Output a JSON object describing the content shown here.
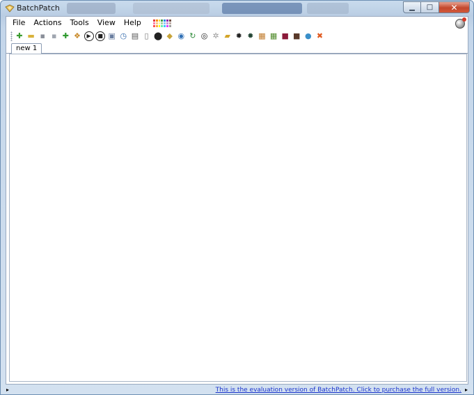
{
  "window": {
    "title": "BatchPatch",
    "controls": {
      "minimize": "▁",
      "maximize": "□",
      "close": "✕"
    }
  },
  "menu": {
    "items": [
      "File",
      "Actions",
      "Tools",
      "View",
      "Help"
    ],
    "palette": [
      "#e53935",
      "#fb8c00",
      "#fdd835",
      "#43a047",
      "#1e88e5",
      "#8e24aa",
      "#6d4c41",
      "#ff80ab",
      "#ffcc80",
      "#fff59d",
      "#a5d6a7",
      "#90caf9",
      "#ce93d8",
      "#bcaaa4",
      "#ff5252",
      "#ffab40",
      "#ffff00",
      "#69f0ae",
      "#40c4ff",
      "#e040fb",
      "#9e9e9e"
    ]
  },
  "toolbar": {
    "icons": [
      {
        "name": "new-icon",
        "glyph": "✚",
        "color": "#3b9b2f",
        "shape": "plain"
      },
      {
        "name": "open-icon",
        "glyph": "▬",
        "color": "#d9b23b",
        "shape": "plain"
      },
      {
        "name": "save-icon",
        "glyph": "▪",
        "color": "#8a8f99",
        "shape": "plain"
      },
      {
        "name": "save-as-icon",
        "glyph": "▪",
        "color": "#a0a6b0",
        "shape": "plain"
      },
      {
        "name": "add-hosts-icon",
        "glyph": "✚",
        "color": "#2f9a2f",
        "shape": "plain"
      },
      {
        "name": "group-icon",
        "glyph": "❖",
        "color": "#c98a2a",
        "shape": "plain"
      },
      {
        "name": "play-icon",
        "glyph": "▶",
        "color": "#222222",
        "shape": "circle"
      },
      {
        "name": "stop-icon",
        "glyph": "■",
        "color": "#222222",
        "shape": "circle"
      },
      {
        "name": "copy-icon",
        "glyph": "▣",
        "color": "#6b7fa0",
        "shape": "plain"
      },
      {
        "name": "clock-icon",
        "glyph": "◷",
        "color": "#3a6fb0",
        "shape": "plain"
      },
      {
        "name": "monitor-icon",
        "glyph": "▤",
        "color": "#555555",
        "shape": "plain"
      },
      {
        "name": "document-icon",
        "glyph": "▯",
        "color": "#777777",
        "shape": "plain"
      },
      {
        "name": "pin-icon",
        "glyph": "⬤",
        "color": "#222222",
        "shape": "plain"
      },
      {
        "name": "diamond-icon",
        "glyph": "◆",
        "color": "#c7a43a",
        "shape": "plain"
      },
      {
        "name": "magnify-icon",
        "glyph": "◉",
        "color": "#2f6fb5",
        "shape": "plain"
      },
      {
        "name": "refresh-icon",
        "glyph": "↻",
        "color": "#2e8b3a",
        "shape": "plain"
      },
      {
        "name": "disc-icon",
        "glyph": "◎",
        "color": "#222222",
        "shape": "plain"
      },
      {
        "name": "settings-icon",
        "glyph": "✲",
        "color": "#9a9a9a",
        "shape": "plain"
      },
      {
        "name": "lock-icon",
        "glyph": "▰",
        "color": "#d4a52a",
        "shape": "plain"
      },
      {
        "name": "gear-icon",
        "glyph": "✹",
        "color": "#222222",
        "shape": "plain"
      },
      {
        "name": "gear-alt-icon",
        "glyph": "✹",
        "color": "#224433",
        "shape": "plain"
      },
      {
        "name": "package-icon",
        "glyph": "▦",
        "color": "#c07a2a",
        "shape": "plain"
      },
      {
        "name": "install-icon",
        "glyph": "▦",
        "color": "#4f8a2a",
        "shape": "plain"
      },
      {
        "name": "terminal-icon",
        "glyph": "■",
        "color": "#8b1a3a",
        "shape": "plain"
      },
      {
        "name": "image-icon",
        "glyph": "■",
        "color": "#5a3a2a",
        "shape": "plain"
      },
      {
        "name": "globe-icon",
        "glyph": "●",
        "color": "#3a8fc9",
        "shape": "plain"
      },
      {
        "name": "delete-icon",
        "glyph": "✖",
        "color": "#e05a20",
        "shape": "plain"
      }
    ]
  },
  "tabs": [
    {
      "label": "new 1"
    }
  ],
  "status": {
    "evaluation_link": "This is the evaluation version of BatchPatch.  Click to purchase the full version.",
    "scroll_left": "▸",
    "scroll_right": "▸"
  }
}
